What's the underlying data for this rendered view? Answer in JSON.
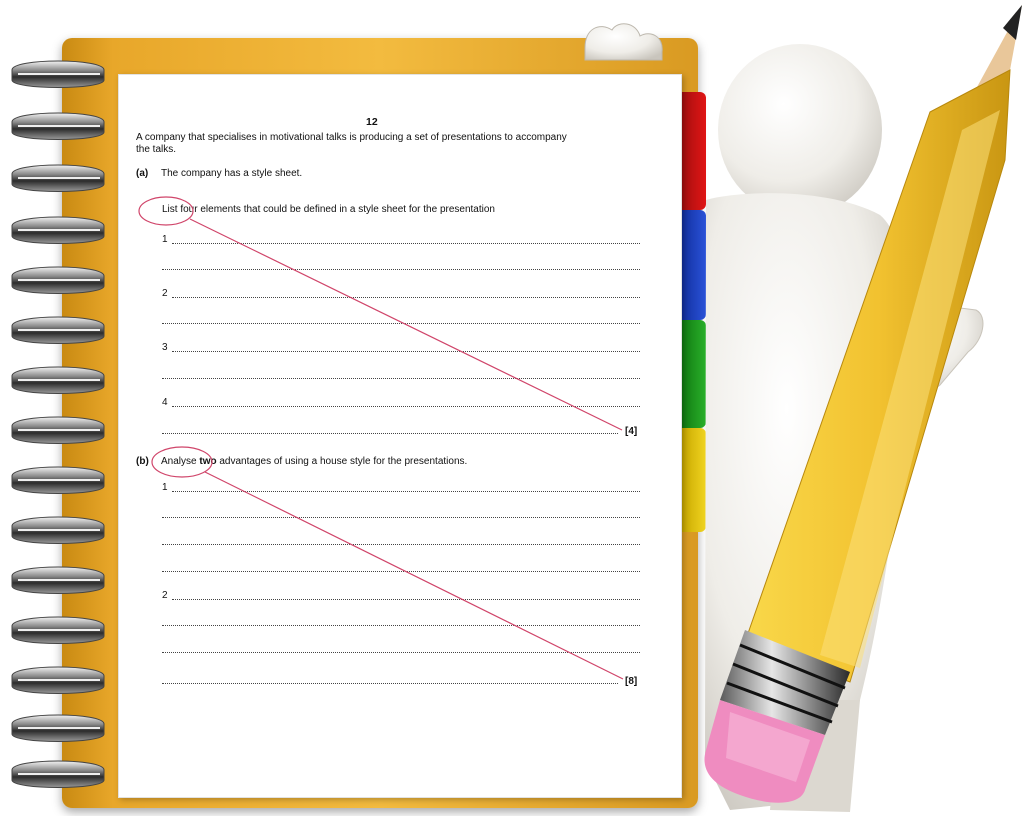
{
  "page_number": "12",
  "intro": [
    "A company that specialises in motivational talks is producing a set of presentations to accompany",
    "the talks."
  ],
  "part_a": {
    "label": "(a)",
    "statement": "The company has a style sheet.",
    "instruction": "List four elements that could be defined in a style sheet for the presentation",
    "items": [
      "1",
      "2",
      "3",
      "4"
    ],
    "marks": "[4]"
  },
  "part_b": {
    "label": "(b)",
    "prompt_before": "Analyse",
    "prompt_bold": "two",
    "prompt_after": "advantages of using a house style for the presentations.",
    "items": [
      "1",
      "2"
    ],
    "marks": "[8]"
  },
  "colors": {
    "tab_red": "#e01515",
    "tab_blue": "#2a52d8",
    "tab_green": "#29b02a",
    "tab_yellow": "#f0d420",
    "annotation": "#d0456a",
    "notebook_cover": "#f3bb3f",
    "pencil": "#f2c230"
  },
  "icons": [
    "spiral-binding-icon",
    "pencil-icon",
    "character-icon"
  ]
}
